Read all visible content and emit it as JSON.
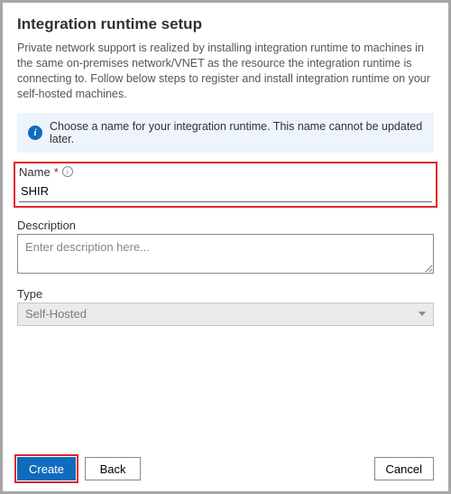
{
  "title": "Integration runtime setup",
  "intro": "Private network support is realized by installing integration runtime to machines in the same on-premises network/VNET as the resource the integration runtime is connecting to. Follow below steps to register and install integration runtime on your self-hosted machines.",
  "infobar": {
    "text": "Choose a name for your integration runtime. This name cannot be updated later."
  },
  "fields": {
    "name": {
      "label": "Name",
      "required_marker": "*",
      "value": "SHIR"
    },
    "description": {
      "label": "Description",
      "placeholder": "Enter description here..."
    },
    "type": {
      "label": "Type",
      "value": "Self-Hosted"
    }
  },
  "buttons": {
    "create": "Create",
    "back": "Back",
    "cancel": "Cancel"
  }
}
